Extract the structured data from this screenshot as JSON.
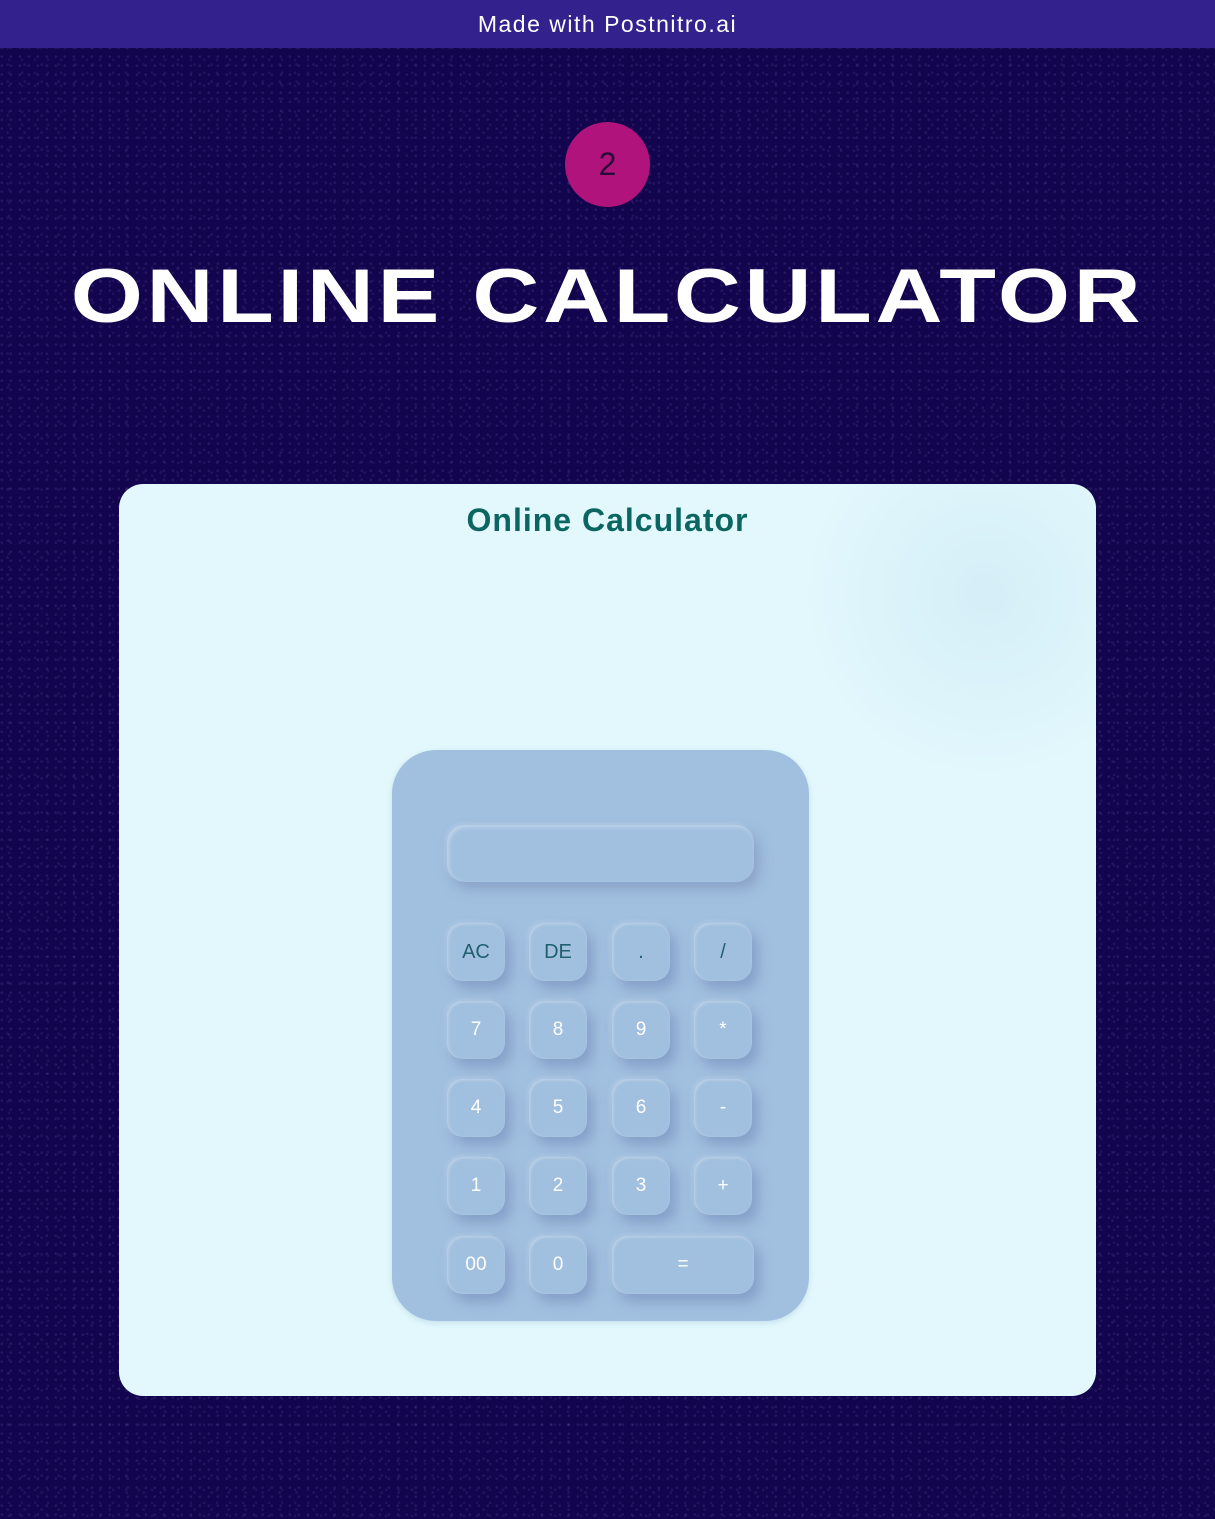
{
  "banner": {
    "text": "Made with Postnitro.ai"
  },
  "step": {
    "number": "2"
  },
  "page": {
    "title": "ONLINE CALCULATOR"
  },
  "card": {
    "title": "Online Calculator"
  },
  "calculator": {
    "display_value": "",
    "keys": {
      "ac": "AC",
      "de": "DE",
      "dot": ".",
      "divide": "/",
      "seven": "7",
      "eight": "8",
      "nine": "9",
      "multiply": "*",
      "four": "4",
      "five": "5",
      "six": "6",
      "minus": "-",
      "one": "1",
      "two": "2",
      "three": "3",
      "plus": "+",
      "double_zero": "00",
      "zero": "0",
      "equals": "="
    }
  },
  "colors": {
    "background": "#13054d",
    "banner": "#33228d",
    "badge": "#b1137c",
    "card": "#e2f8fd",
    "card_title": "#0b6661",
    "calculator_body": "#a1bfdf"
  }
}
